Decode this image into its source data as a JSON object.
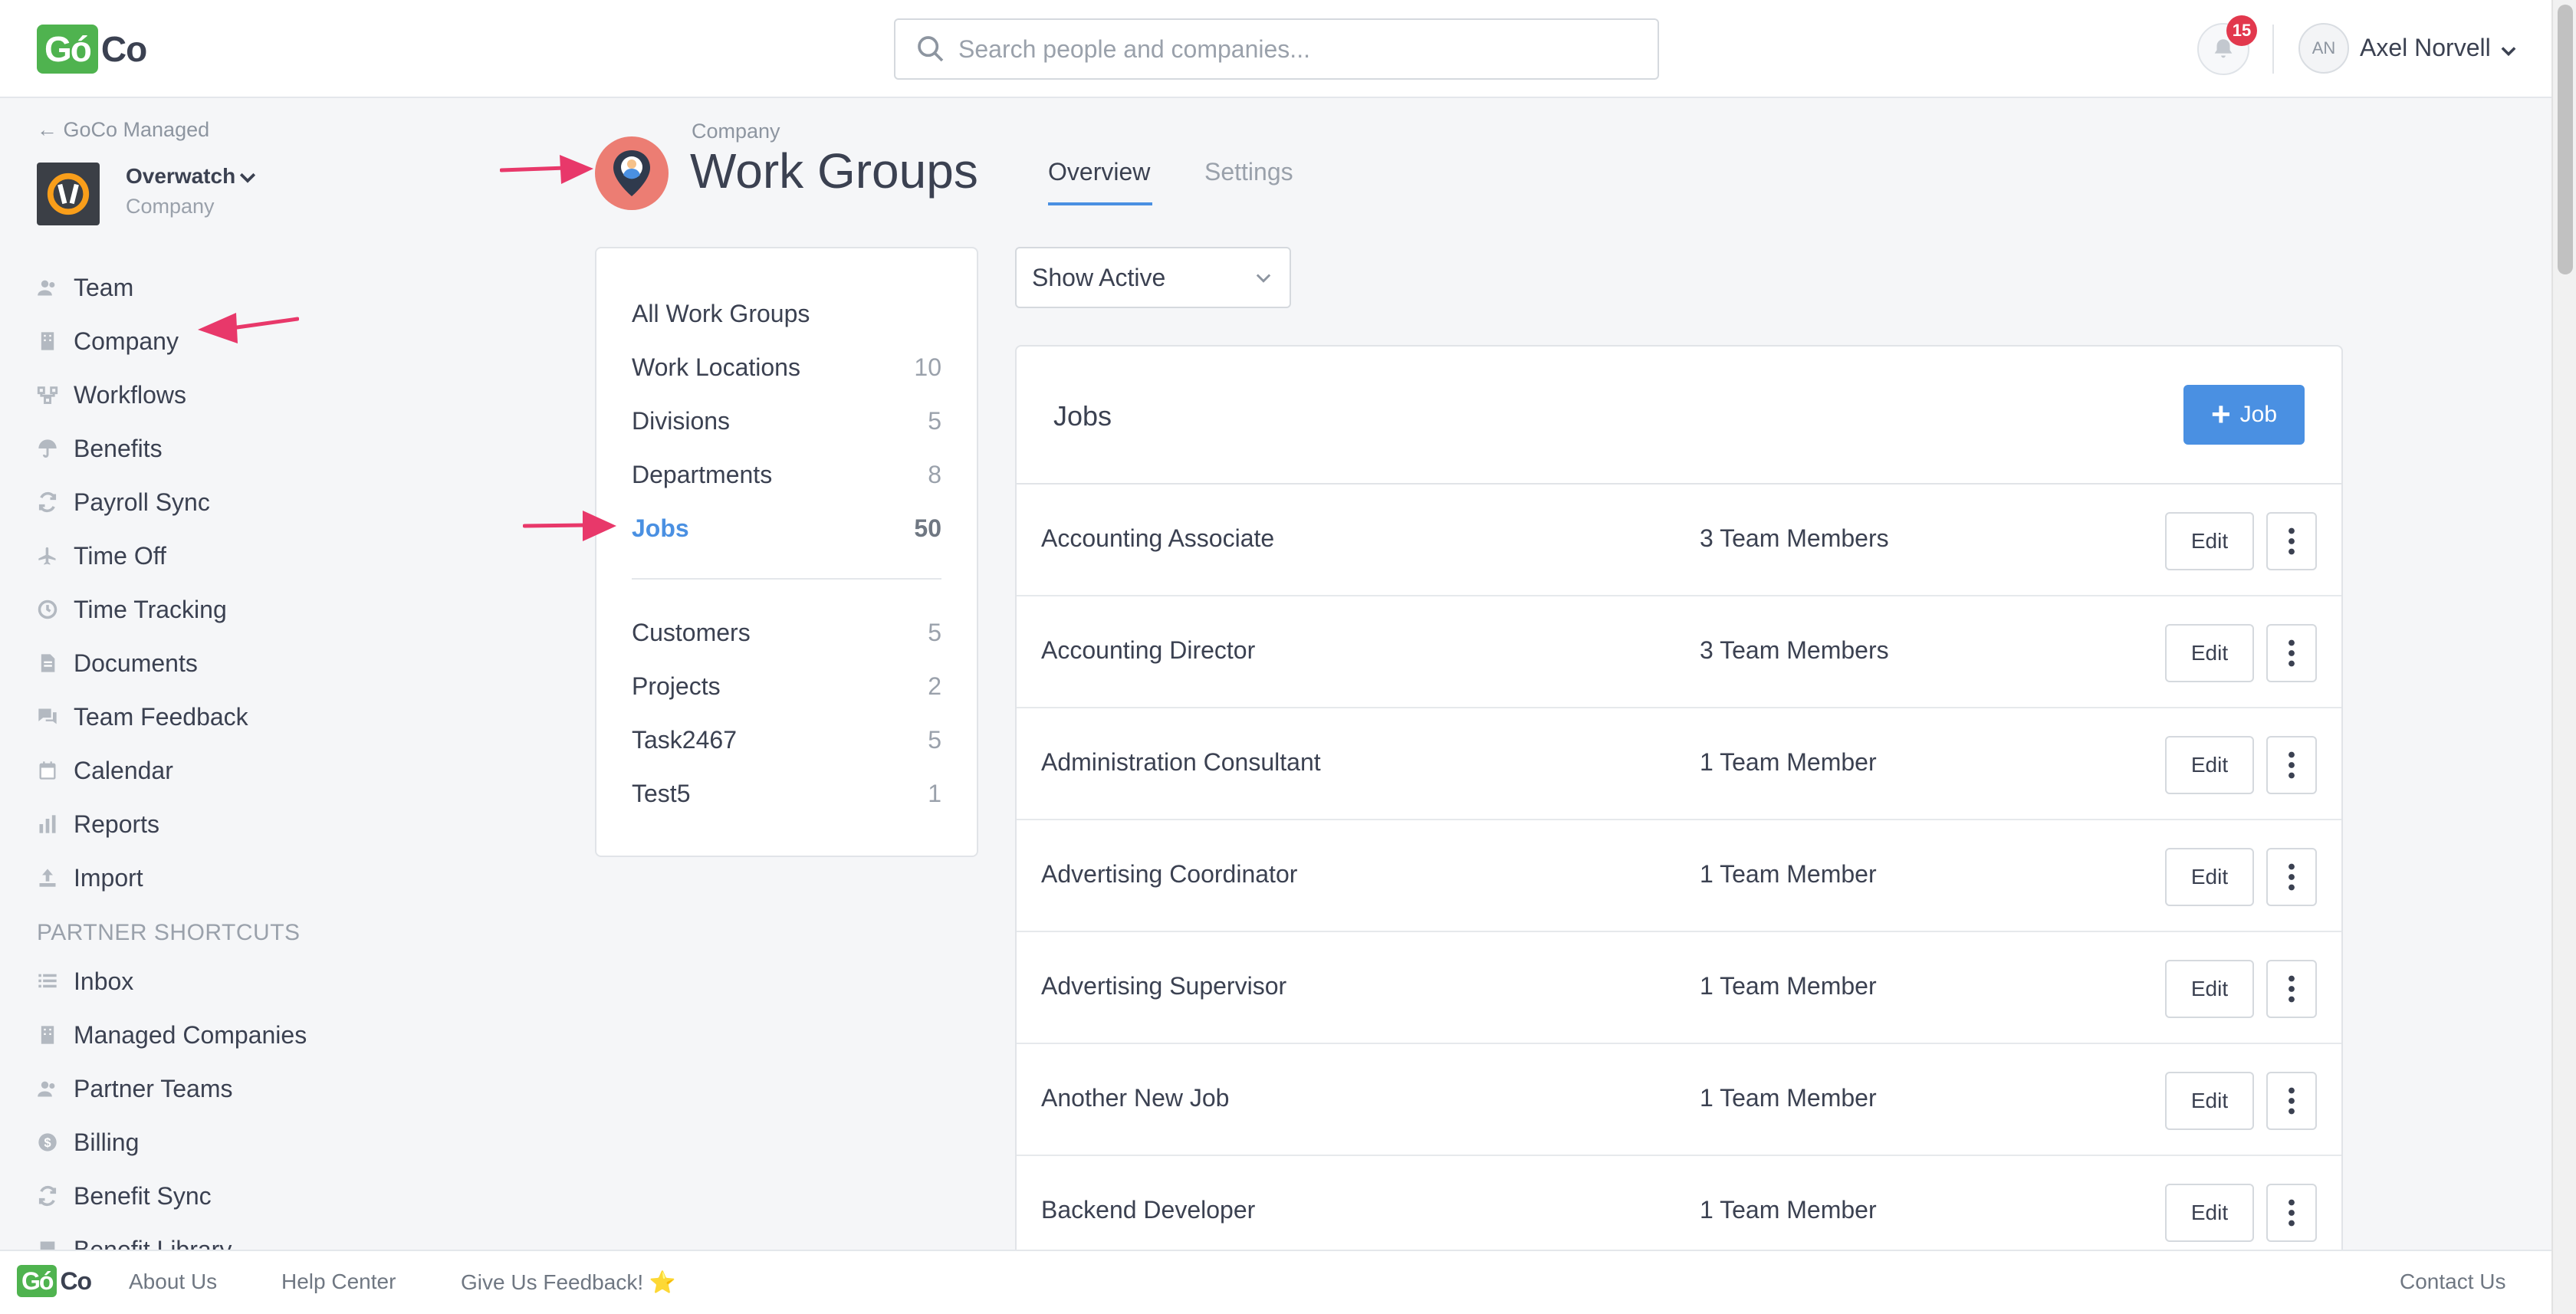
{
  "colors": {
    "accent": "#4a90e2",
    "brand_green": "#4fb34f",
    "badge_red": "#e2384d",
    "annotation_arrow": "#e8386a",
    "work_group_icon_bg": "#ec7d73"
  },
  "app": {
    "logo_go": "Gó",
    "logo_co": "Co"
  },
  "header": {
    "search_placeholder": "Search people and companies...",
    "notification_count": "15",
    "user_initials": "AN",
    "user_name": "Axel Norvell"
  },
  "sidebar": {
    "back_link": "← GoCo Managed",
    "company_name": "Overwatch",
    "company_type": "Company",
    "items": [
      {
        "label": "Team",
        "icon": "team-icon"
      },
      {
        "label": "Company",
        "icon": "building-icon"
      },
      {
        "label": "Workflows",
        "icon": "workflow-icon"
      },
      {
        "label": "Benefits",
        "icon": "umbrella-icon"
      },
      {
        "label": "Payroll Sync",
        "icon": "sync-icon"
      },
      {
        "label": "Time Off",
        "icon": "plane-icon"
      },
      {
        "label": "Time Tracking",
        "icon": "clock-icon"
      },
      {
        "label": "Documents",
        "icon": "document-icon"
      },
      {
        "label": "Team Feedback",
        "icon": "chat-icon"
      },
      {
        "label": "Calendar",
        "icon": "calendar-icon"
      },
      {
        "label": "Reports",
        "icon": "bar-chart-icon"
      },
      {
        "label": "Import",
        "icon": "upload-icon"
      }
    ],
    "partner_header": "PARTNER SHORTCUTS",
    "partner_items": [
      {
        "label": "Inbox",
        "icon": "list-icon"
      },
      {
        "label": "Managed Companies",
        "icon": "building-icon"
      },
      {
        "label": "Partner Teams",
        "icon": "team-icon"
      },
      {
        "label": "Billing",
        "icon": "dollar-icon"
      },
      {
        "label": "Benefit Sync",
        "icon": "sync-icon"
      },
      {
        "label": "Benefit Library",
        "icon": "book-icon"
      }
    ]
  },
  "page": {
    "breadcrumb": "Company",
    "title": "Work Groups",
    "tabs": [
      {
        "label": "Overview",
        "active": true
      },
      {
        "label": "Settings",
        "active": false
      }
    ]
  },
  "work_groups": {
    "all_label": "All Work Groups",
    "groups": [
      {
        "label": "Work Locations",
        "count": "10"
      },
      {
        "label": "Divisions",
        "count": "5"
      },
      {
        "label": "Departments",
        "count": "8"
      },
      {
        "label": "Jobs",
        "count": "50",
        "active": true
      }
    ],
    "custom_groups": [
      {
        "label": "Customers",
        "count": "5"
      },
      {
        "label": "Projects",
        "count": "2"
      },
      {
        "label": "Task2467",
        "count": "5"
      },
      {
        "label": "Test5",
        "count": "1"
      }
    ]
  },
  "filter": {
    "selected": "Show Active"
  },
  "jobs": {
    "title": "Jobs",
    "add_label": "Job",
    "edit_label": "Edit",
    "rows": [
      {
        "name": "Accounting Associate",
        "members": "3 Team Members"
      },
      {
        "name": "Accounting Director",
        "members": "3 Team Members"
      },
      {
        "name": "Administration Consultant",
        "members": "1 Team Member"
      },
      {
        "name": "Advertising Coordinator",
        "members": "1 Team Member"
      },
      {
        "name": "Advertising Supervisor",
        "members": "1 Team Member"
      },
      {
        "name": "Another New Job",
        "members": "1 Team Member"
      },
      {
        "name": "Backend Developer",
        "members": "1 Team Member"
      }
    ]
  },
  "footer": {
    "links": [
      "About Us",
      "Help Center",
      "Give Us Feedback! ⭐"
    ],
    "contact": "Contact Us"
  }
}
